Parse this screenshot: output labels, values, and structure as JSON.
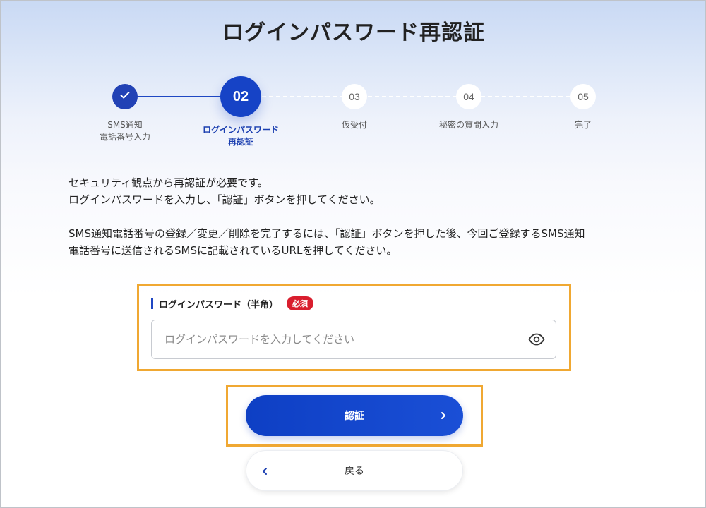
{
  "page": {
    "title": "ログインパスワード再認証"
  },
  "stepper": {
    "steps": [
      {
        "number": "",
        "label_line1": "SMS通知",
        "label_line2": "電話番号入力",
        "state": "done"
      },
      {
        "number": "02",
        "label_line1": "ログインパスワード",
        "label_line2": "再認証",
        "state": "active"
      },
      {
        "number": "03",
        "label_line1": "仮受付",
        "label_line2": "",
        "state": "todo"
      },
      {
        "number": "04",
        "label_line1": "秘密の質問入力",
        "label_line2": "",
        "state": "todo"
      },
      {
        "number": "05",
        "label_line1": "完了",
        "label_line2": "",
        "state": "todo"
      }
    ]
  },
  "description": {
    "line1": "セキュリティ観点から再認証が必要です。",
    "line2": "ログインパスワードを入力し、「認証」ボタンを押してください。",
    "line3": "SMS通知電話番号の登録／変更／削除を完了するには、「認証」ボタンを押した後、今回ご登録するSMS通知",
    "line4": "電話番号に送信されるSMSに記載されているURLを押してください。"
  },
  "password_field": {
    "label": "ログインパスワード（半角）",
    "required_badge": "必須",
    "placeholder": "ログインパスワードを入力してください",
    "value": "",
    "icon": "eye-icon"
  },
  "buttons": {
    "authenticate_label": "認証",
    "back_label": "戻る"
  },
  "colors": {
    "primary": "#1643c6",
    "required": "#d91e2e",
    "highlight": "#f0a832"
  }
}
